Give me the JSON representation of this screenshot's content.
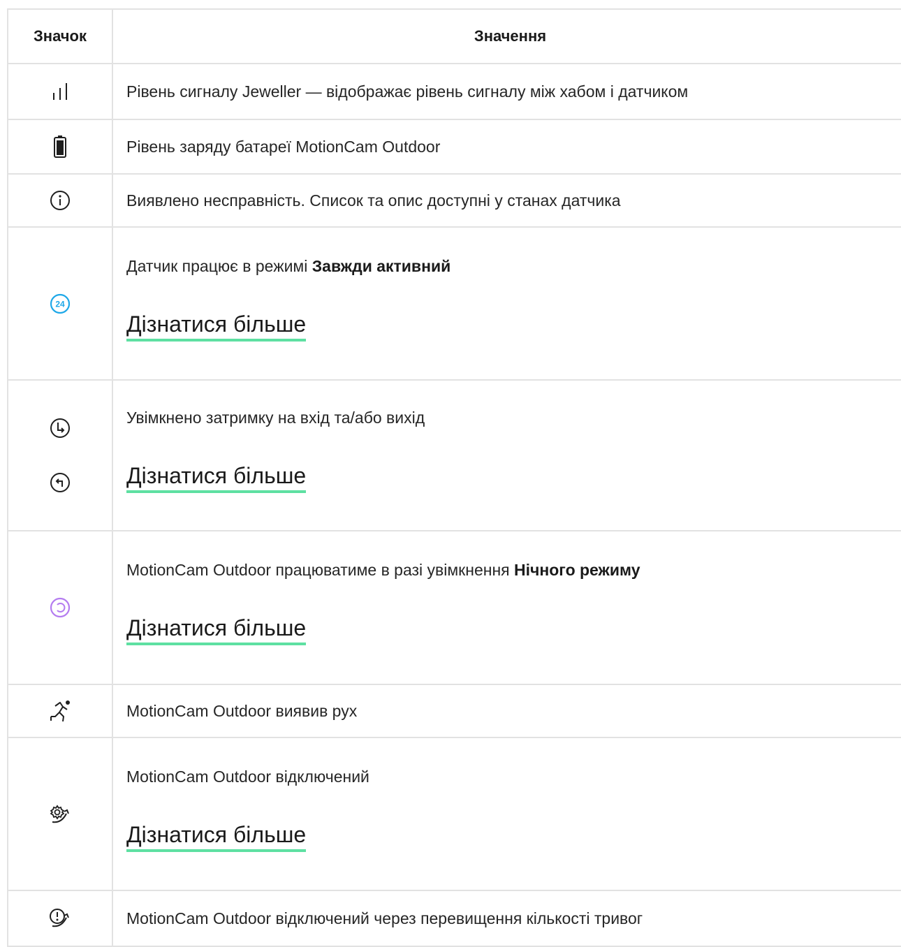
{
  "header": {
    "icon_col": "Значок",
    "meaning_col": "Значення"
  },
  "rows": [
    {
      "icons": [
        "signal-strength-icon"
      ],
      "text": "Рівень сигналу Jeweller — відображає рівень сигналу між хабом і датчиком"
    },
    {
      "icons": [
        "battery-icon"
      ],
      "text": "Рівень заряду батареї MotionCam Outdoor"
    },
    {
      "icons": [
        "info-circle-icon"
      ],
      "text": "Виявлено несправність. Список та опис доступні у станах датчика"
    },
    {
      "icons": [
        "always-active-24-icon"
      ],
      "text": "Датчик працює в режимі ",
      "bold": "Завжди активний",
      "link": "Дізнатися більше",
      "badge": "24"
    },
    {
      "icons": [
        "entry-delay-clock-icon",
        "exit-delay-clock-icon"
      ],
      "text": "Увімкнено затримку на вхід та/або вихід",
      "link": "Дізнатися більше"
    },
    {
      "icons": [
        "night-mode-icon"
      ],
      "text": "MotionCam Outdoor працюватиме в разі увімкнення ",
      "bold": "Нічного режиму",
      "link": "Дізнатися більше"
    },
    {
      "icons": [
        "motion-detected-icon"
      ],
      "text": "MotionCam Outdoor виявив рух"
    },
    {
      "icons": [
        "device-disabled-gear-icon"
      ],
      "text": "MotionCam Outdoor відключений",
      "link": "Дізнатися більше"
    },
    {
      "icons": [
        "disabled-alarm-limit-icon"
      ],
      "text": "MotionCam Outdoor відключений через перевищення кількості тривог"
    }
  ],
  "colors": {
    "link_underline": "#5ee0a2",
    "always_active_blue": "#1ea8e8",
    "night_mode_purple": "#b47cf0",
    "border": "#e2e2e2"
  }
}
